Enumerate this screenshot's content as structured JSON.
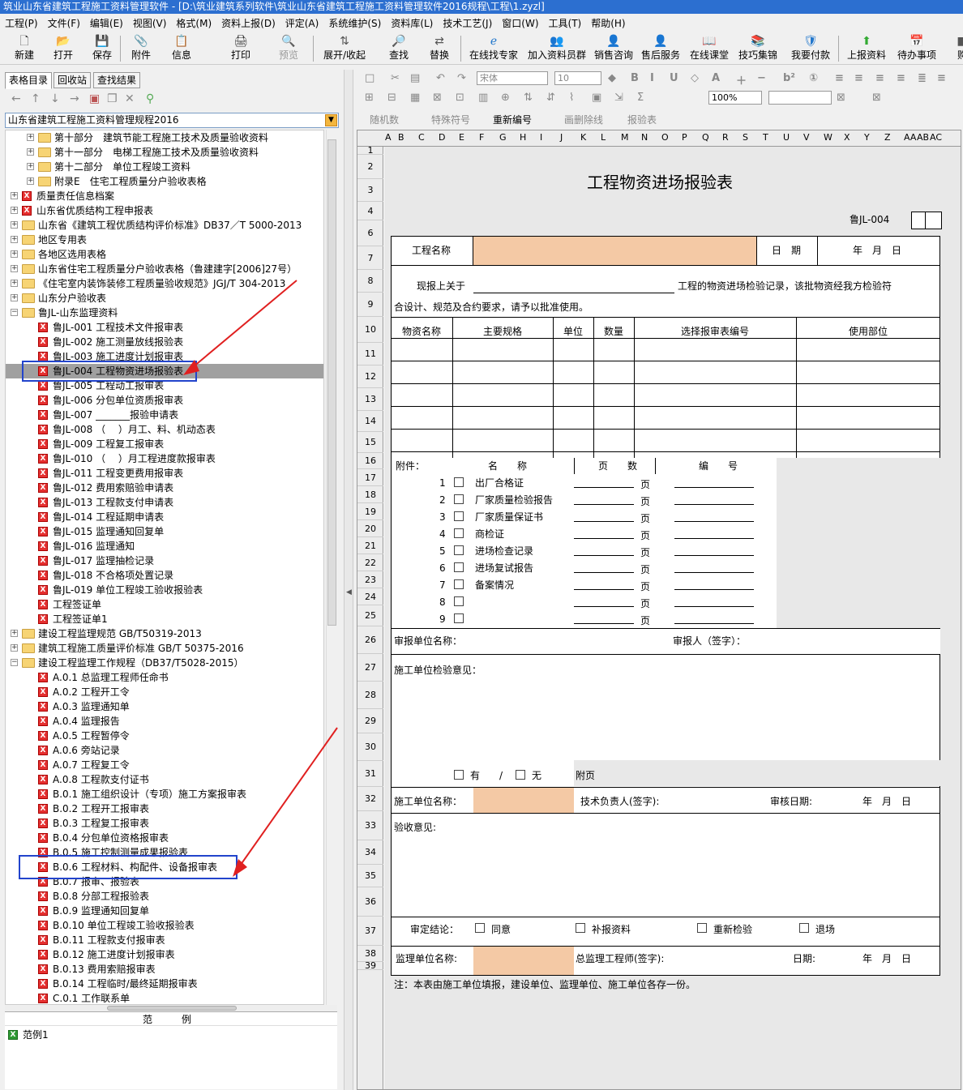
{
  "window": {
    "title": "筑业山东省建筑工程施工资料管理软件 - [D:\\筑业建筑系列软件\\筑业山东省建筑工程施工资料管理软件2016规程\\工程\\1.zyzl]"
  },
  "menu": [
    "工程(P)",
    "文件(F)",
    "编辑(E)",
    "视图(V)",
    "格式(M)",
    "资料上报(D)",
    "评定(A)",
    "系统维护(S)",
    "资料库(L)",
    "技术工艺(J)",
    "窗口(W)",
    "工具(T)",
    "帮助(H)"
  ],
  "toolbar": [
    "新建",
    "打开",
    "保存",
    "附件",
    "信息",
    "打印",
    "预览",
    "展开/收起",
    "查找",
    "替换",
    "在线找专家",
    "加入资料员群",
    "销售咨询",
    "售后服务",
    "在线课堂",
    "技巧集锦",
    "我要付款",
    "上报资料",
    "待办事项",
    "购"
  ],
  "left": {
    "tabs": [
      "表格目录",
      "回收站",
      "查找结果"
    ],
    "combo": "山东省建筑工程施工资料管理规程2016",
    "tree": [
      {
        "t": "第十部分　建筑节能工程施工技术及质量验收资料"
      },
      {
        "t": "第十一部分　电梯工程施工技术及质量验收资料"
      },
      {
        "t": "第十二部分　单位工程竣工资料"
      },
      {
        "t": "附录E　住宅工程质量分户验收表格"
      },
      {
        "t": "质量责任信息档案"
      },
      {
        "t": "山东省优质结构工程申报表"
      },
      {
        "t": "山东省《建筑工程优质结构评价标准》DB37／T 5000-2013"
      },
      {
        "t": "地区专用表"
      },
      {
        "t": "各地区选用表格"
      },
      {
        "t": "山东省住宅工程质量分户验收表格（鲁建建字[2006]27号）"
      },
      {
        "t": "《住宅室内装饰装修工程质量验收规范》JGJ/T 304-2013"
      },
      {
        "t": "山东分户验收表"
      },
      {
        "t": "鲁JL-山东监理资料"
      },
      {
        "t": "鲁JL-001 工程技术文件报审表"
      },
      {
        "t": "鲁JL-002 施工测量放线报验表"
      },
      {
        "t": "鲁JL-003 施工进度计划报审表"
      },
      {
        "t": "鲁JL-004 工程物资进场报验表"
      },
      {
        "t": "鲁JL-005 工程动工报审表"
      },
      {
        "t": "鲁JL-006 分包单位资质报审表"
      },
      {
        "t": "鲁JL-007 _______报验申请表"
      },
      {
        "t": "鲁JL-008 （　 ）月工、料、机动态表"
      },
      {
        "t": "鲁JL-009 工程复工报审表"
      },
      {
        "t": "鲁JL-010 （　 ）月工程进度款报审表"
      },
      {
        "t": "鲁JL-011 工程变更费用报审表"
      },
      {
        "t": "鲁JL-012 费用索赔验申请表"
      },
      {
        "t": "鲁JL-013 工程款支付申请表"
      },
      {
        "t": "鲁JL-014 工程延期申请表"
      },
      {
        "t": "鲁JL-015 监理通知回复单"
      },
      {
        "t": "鲁JL-016 监理通知"
      },
      {
        "t": "鲁JL-017 监理抽检记录"
      },
      {
        "t": "鲁JL-018 不合格项处置记录"
      },
      {
        "t": "鲁JL-019 单位工程竣工验收报验表"
      },
      {
        "t": "工程签证单"
      },
      {
        "t": "工程签证单1"
      },
      {
        "t": "建设工程监理规范 GB/T50319-2013"
      },
      {
        "t": "建筑工程施工质量评价标准 GB/T 50375-2016"
      },
      {
        "t": "建设工程监理工作规程（DB37/T5028-2015）"
      },
      {
        "t": "A.0.1 总监理工程师任命书"
      },
      {
        "t": "A.0.2 工程开工令"
      },
      {
        "t": "A.0.3 监理通知单"
      },
      {
        "t": "A.0.4 监理报告"
      },
      {
        "t": "A.0.5 工程暂停令"
      },
      {
        "t": "A.0.6 旁站记录"
      },
      {
        "t": "A.0.7 工程复工令"
      },
      {
        "t": "A.0.8 工程款支付证书"
      },
      {
        "t": "B.0.1 施工组织设计（专项）施工方案报审表"
      },
      {
        "t": "B.0.2 工程开工报审表"
      },
      {
        "t": "B.0.3 工程复工报审表"
      },
      {
        "t": "B.0.4 分包单位资格报审表"
      },
      {
        "t": "B.0.5 施工控制测量成果报验表"
      },
      {
        "t": "B.0.6 工程材料、构配件、设备报审表"
      },
      {
        "t": "B.0.7 报审、报验表"
      },
      {
        "t": "B.0.8 分部工程报验表"
      },
      {
        "t": "B.0.9 监理通知回复单"
      },
      {
        "t": "B.0.10 单位工程竣工验收报验表"
      },
      {
        "t": "B.0.11 工程款支付报审表"
      },
      {
        "t": "B.0.12 施工进度计划报审表"
      },
      {
        "t": "B.0.13 费用索赔报审表"
      },
      {
        "t": "B.0.14 工程临时/最终延期报审表"
      },
      {
        "t": "C.0.1 工作联系单"
      }
    ],
    "example_header": "范　　　例",
    "example_item": "范例1"
  },
  "right_toolbar": {
    "font": "宋体",
    "size": "10",
    "zoom": "100%",
    "row3": [
      "随机数",
      "特殊符号",
      "重新编号",
      "画删除线",
      "报验表"
    ]
  },
  "columns": [
    "A",
    "B",
    "C",
    "D",
    "E",
    "F",
    "G",
    "H",
    "I",
    "J",
    "K",
    "L",
    "M",
    "N",
    "O",
    "P",
    "Q",
    "R",
    "S",
    "T",
    "U",
    "V",
    "W",
    "X",
    "Y",
    "Z",
    "AA",
    "AB",
    "AC"
  ],
  "rows": [
    "1",
    "2",
    "3",
    "4",
    "6",
    "7",
    "8",
    "9",
    "10",
    "11",
    "12",
    "13",
    "14",
    "15",
    "16",
    "17",
    "18",
    "19",
    "20",
    "21",
    "22",
    "23",
    "24",
    "25",
    "26",
    "27",
    "28",
    "29",
    "30",
    "31",
    "32",
    "33",
    "34",
    "35",
    "36",
    "37",
    "38",
    "39"
  ],
  "form": {
    "title": "工程物资进场报验表",
    "code": "鲁JL-004",
    "project_name": "工程名称",
    "date_label": "日　期",
    "date_value": "年　月　日",
    "intro1": "现报上关于",
    "intro2": "工程的物资进场检验记录，该批物资经我方检验符",
    "intro3": "合设计、规范及合约要求，请予以批准使用。",
    "headers": [
      "物资名称",
      "主要规格",
      "单位",
      "数量",
      "选择报审表编号",
      "使用部位"
    ],
    "attach_label": "附件：",
    "attach_name": "名　　称",
    "attach_pages": "页　　数",
    "attach_no": "编　　号",
    "attachments": [
      "出厂合格证",
      "厂家质量检验报告",
      "厂家质量保证书",
      "商检证",
      "进场检查记录",
      "进场复试报告",
      "备案情况",
      "",
      ""
    ],
    "page_unit": "页",
    "submit_unit": "审报单位名称：",
    "reviewer": "审报人（签字）：",
    "inspect_opinion": "施工单位检验意见：",
    "yes": "有",
    "slash": "/",
    "no": "无",
    "appendix": "附页",
    "contractor_name": "施工单位名称：",
    "tech_lead": "技术负责人(签字):",
    "review_date": "审核日期:",
    "accept_opinion": "验收意见:",
    "conclusion": "审定结论：",
    "agree": "同意",
    "supplement": "补报资料",
    "recheck": "重新检验",
    "return": "退场",
    "supervisor_unit": "监理单位名称:",
    "chief_engineer": "总监理工程师(签字):",
    "date2": "日期:",
    "note": "注：本表由施工单位填报，建设单位、监理单位、施工单位各存一份。"
  },
  "colors": {
    "titlebar": "#2c6fd0",
    "fill": "#f4c9a5",
    "annotation": "#2244cc",
    "arrow": "#e02020"
  }
}
